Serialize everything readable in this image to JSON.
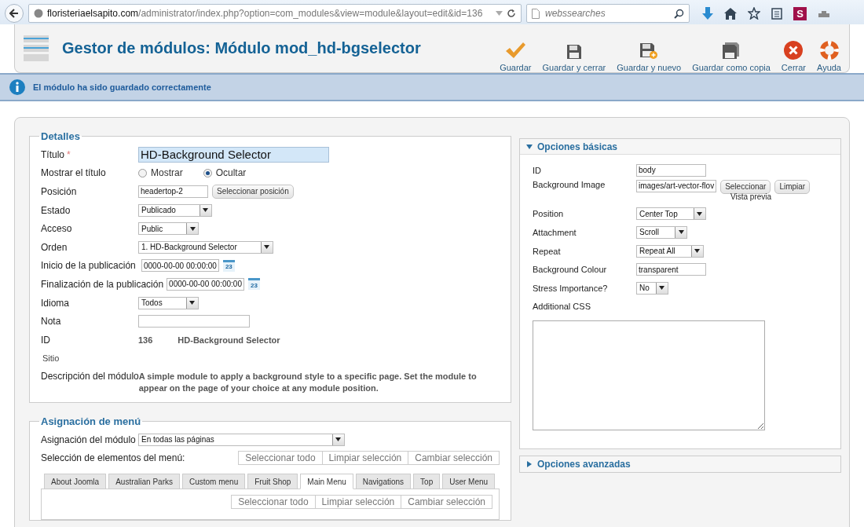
{
  "browser": {
    "url_host": "floristeriaelsapito.com",
    "url_path": "/administrator/index.php?option=com_modules&view=module&layout=edit&id=136",
    "search_placeholder": "webssearches",
    "badge": "S"
  },
  "header": {
    "title": "Gestor de módulos: Módulo mod_hd-bgselector",
    "toolbar": [
      {
        "kind": "check",
        "label": "Guardar"
      },
      {
        "kind": "save",
        "label": "Guardar y cerrar"
      },
      {
        "kind": "save-new",
        "label": "Guardar y nuevo"
      },
      {
        "kind": "save-copy",
        "label": "Guardar como copia"
      },
      {
        "kind": "close",
        "label": "Cerrar"
      },
      {
        "kind": "help",
        "label": "Ayuda"
      }
    ]
  },
  "message": "El módulo ha sido guardado correctamente",
  "details": {
    "legend": "Detalles",
    "rows": [
      {
        "kind": "text",
        "label": "Título",
        "required_mark": "*",
        "value": "HD-Background Selector"
      },
      {
        "kind": "radio",
        "label": "Mostrar el título",
        "options": [
          {
            "label": "Mostrar",
            "selected": false
          },
          {
            "label": "Ocultar",
            "selected": true
          }
        ]
      },
      {
        "kind": "text-button",
        "label": "Posición",
        "value": "headertop-2",
        "button": "Seleccionar posición"
      },
      {
        "kind": "select",
        "label": "Estado",
        "value": "Publicado"
      },
      {
        "kind": "select",
        "label": "Acceso",
        "value": "Public"
      },
      {
        "kind": "select",
        "label": "Orden",
        "value": "1. HD-Background Selector"
      },
      {
        "kind": "date",
        "label": "Inicio de la publicación",
        "value": "0000-00-00 00:00:00",
        "icon_text": "23"
      },
      {
        "kind": "date",
        "label": "Finalización de la publicación",
        "value": "0000-00-00 00:00:00",
        "icon_text": "23"
      },
      {
        "kind": "select",
        "label": "Idioma",
        "value": "Todos"
      },
      {
        "kind": "note",
        "label": "Nota"
      },
      {
        "kind": "static",
        "label": "ID",
        "values": [
          "136",
          "HD-Background Selector"
        ]
      },
      {
        "kind": "heading",
        "label": "Sitio"
      },
      {
        "kind": "description",
        "label": "Descripción del módulo",
        "text": "A simple module to apply a background style to a specific page. Set the module to appear on the page of your choice at any module position."
      }
    ]
  },
  "menu_assignment": {
    "legend": "Asignación de menú",
    "assignment_label": "Asignación del módulo",
    "assignment_value": "En todas las páginas",
    "selection_label": "Selección de elementos del menú:",
    "buttons": [
      "Seleccionar todo",
      "Limpiar selección",
      "Cambiar selección"
    ],
    "tabs": [
      {
        "label": "About Joomla",
        "selected": false
      },
      {
        "label": "Australian Parks",
        "selected": false
      },
      {
        "label": "Custom menu",
        "selected": false
      },
      {
        "label": "Fruit Shop",
        "selected": false
      },
      {
        "label": "Main Menu",
        "selected": true
      },
      {
        "label": "Navigations",
        "selected": false
      },
      {
        "label": "Top",
        "selected": false
      },
      {
        "label": "User Menu",
        "selected": false
      }
    ],
    "panel_buttons": [
      "Seleccionar todo",
      "Limpiar selección",
      "Cambiar selección"
    ]
  },
  "options": [
    {
      "title": "Opciones básicas",
      "expanded": true,
      "rows": [
        {
          "kind": "text",
          "label": "ID",
          "value": "body"
        },
        {
          "kind": "media",
          "label": "Background Image",
          "value": "images/art-vector-flov",
          "buttons": [
            "Seleccionar",
            "Limpiar"
          ],
          "note": "Vista previa"
        },
        {
          "kind": "select",
          "label": "Position",
          "value": "Center Top"
        },
        {
          "kind": "select",
          "label": "Attachment",
          "value": "Scroll"
        },
        {
          "kind": "select",
          "label": "Repeat",
          "value": "Repeat All"
        },
        {
          "kind": "text",
          "label": "Background Colour",
          "value": "transparent"
        },
        {
          "kind": "select",
          "label": "Stress Importance?",
          "value": "No"
        },
        {
          "kind": "textarea",
          "label": "Additional CSS"
        }
      ]
    },
    {
      "title": "Opciones avanzadas",
      "expanded": false
    }
  ]
}
